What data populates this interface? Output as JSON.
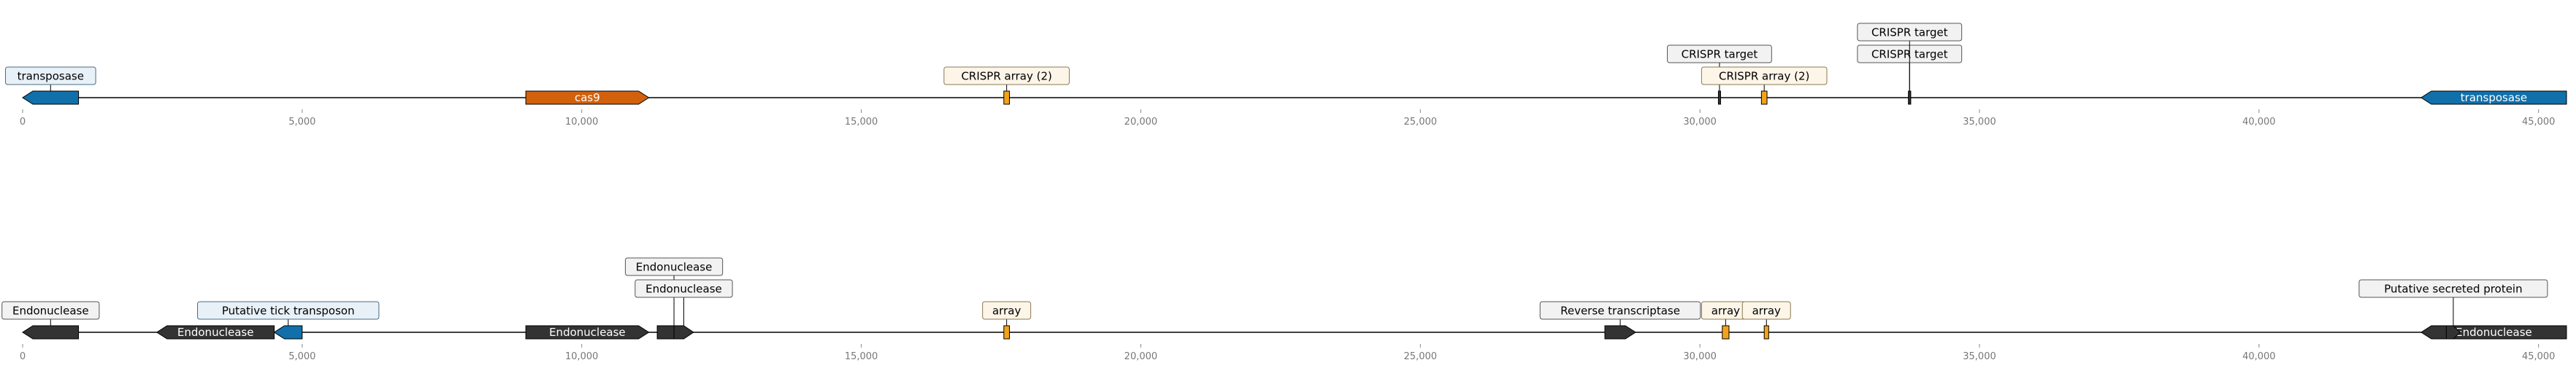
{
  "axis": {
    "min": 0,
    "max": 45500,
    "ticks": [
      {
        "value": 0,
        "label": "0"
      },
      {
        "value": 5000,
        "label": "5,000"
      },
      {
        "value": 10000,
        "label": "10,000"
      },
      {
        "value": 15000,
        "label": "15,000"
      },
      {
        "value": 20000,
        "label": "20,000"
      },
      {
        "value": 25000,
        "label": "25,000"
      },
      {
        "value": 30000,
        "label": "30,000"
      },
      {
        "value": 35000,
        "label": "35,000"
      },
      {
        "value": 40000,
        "label": "40,000"
      },
      {
        "value": 45000,
        "label": "45,000"
      }
    ]
  },
  "colors": {
    "transposase": "#1170aa",
    "cas9": "#d1610d",
    "crispr": "#f2a31b",
    "dark": "#333333",
    "label_fill_blue": "#e8f1f8",
    "label_fill_orange": "#fcf5e8",
    "label_fill_gray": "#f2f2f2"
  },
  "tracks": [
    {
      "id": "top",
      "features": [
        {
          "start": 0,
          "end": 1000,
          "strand": -1,
          "color": "#1170aa",
          "label": "transposase",
          "label_style": "box-blue",
          "label_level": 1
        },
        {
          "start": 9000,
          "end": 11200,
          "strand": 1,
          "color": "#d1610d",
          "label": "cas9",
          "label_style": "inline"
        },
        {
          "start": 17550,
          "end": 17650,
          "strand": 0,
          "color": "#f2a31b",
          "label": "CRISPR array (2)",
          "label_style": "box-orange",
          "label_level": 1
        },
        {
          "start": 30340,
          "end": 30360,
          "strand": 0,
          "color": "#333333",
          "label": "CRISPR target",
          "label_style": "box-gray",
          "label_level": 2
        },
        {
          "start": 31100,
          "end": 31200,
          "strand": 0,
          "color": "#f2a31b",
          "label": "CRISPR array (2)",
          "label_style": "box-orange",
          "label_level": 1
        },
        {
          "start": 33740,
          "end": 33760,
          "strand": 0,
          "color": "#333333",
          "label": "CRISPR target",
          "label_style": "box-gray",
          "label_level": 2
        },
        {
          "start": 33740,
          "end": 33760,
          "strand": 0,
          "color": "#333333",
          "label": "CRISPR target",
          "label_style": "box-gray",
          "label_level": 3
        },
        {
          "start": 42900,
          "end": 45500,
          "strand": -1,
          "color": "#1170aa",
          "label": "transposase",
          "label_style": "inline"
        }
      ]
    },
    {
      "id": "bottom",
      "features": [
        {
          "start": 0,
          "end": 1000,
          "strand": -1,
          "color": "#333333",
          "label": "Endonuclease",
          "label_style": "box-gray",
          "label_level": 1
        },
        {
          "start": 2400,
          "end": 4500,
          "strand": -1,
          "color": "#333333",
          "label": "Endonuclease",
          "label_style": "inline"
        },
        {
          "start": 4500,
          "end": 5000,
          "strand": -1,
          "color": "#1170aa",
          "label": "Putative tick transposon",
          "label_style": "box-blue",
          "label_level": 1
        },
        {
          "start": 9000,
          "end": 11200,
          "strand": 1,
          "color": "#333333",
          "label": "Endonuclease",
          "label_style": "inline"
        },
        {
          "start": 11350,
          "end": 11950,
          "strand": 1,
          "color": "#333333",
          "label": "Endonuclease",
          "label_style": "box-gray",
          "label_level": 3
        },
        {
          "start": 11650,
          "end": 12000,
          "strand": 1,
          "color": "#333333",
          "label": "Endonuclease",
          "label_style": "box-gray",
          "label_level": 2
        },
        {
          "start": 17550,
          "end": 17650,
          "strand": 0,
          "color": "#f2a31b",
          "label": "array",
          "label_style": "box-orange",
          "label_level": 1
        },
        {
          "start": 28300,
          "end": 28850,
          "strand": 1,
          "color": "#333333",
          "label": "Reverse transcriptase",
          "label_style": "box-gray",
          "label_level": 1
        },
        {
          "start": 30400,
          "end": 30520,
          "strand": 0,
          "color": "#f2a31b",
          "label": "array",
          "label_style": "box-orange",
          "label_level": 1
        },
        {
          "start": 31150,
          "end": 31230,
          "strand": 0,
          "color": "#f2a31b",
          "label": "array",
          "label_style": "box-orange",
          "label_level": 1
        },
        {
          "start": 42900,
          "end": 45500,
          "strand": -1,
          "color": "#333333",
          "label": "Endonuclease",
          "label_style": "inline"
        },
        {
          "start": 43350,
          "end": 43600,
          "strand": 1,
          "color": "#333333",
          "label": "Putative secreted protein",
          "label_style": "box-gray",
          "label_level": 2
        }
      ]
    }
  ]
}
